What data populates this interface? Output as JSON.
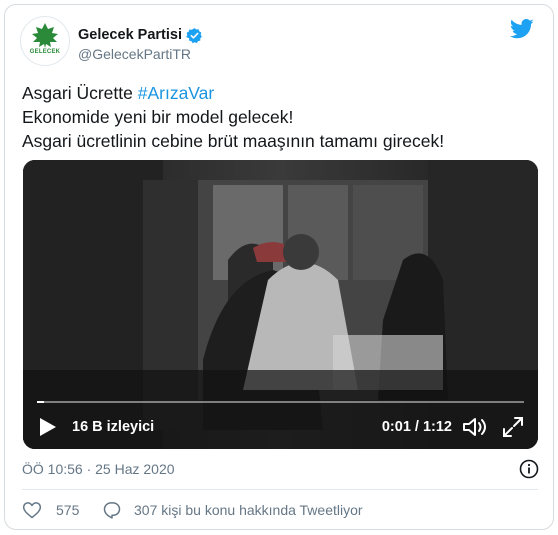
{
  "account": {
    "display_name": "Gelecek Partisi",
    "handle": "@GelecekPartiTR",
    "avatar_text": "GELECEK",
    "avatar_color": "#2a8a3a",
    "verified": true,
    "verified_icon": "verified-badge-icon",
    "logo_icon": "twitter-bird-icon"
  },
  "tweet": {
    "line1_prefix": "Asgari Ücrette ",
    "line1_hashtag": "#ArızaVar",
    "line2": "Ekonomide yeni bir model gelecek!",
    "line3": "Asgari ücretlinin cebine brüt maaşının tamamı girecek!",
    "hashtag_color": "#1b95e0"
  },
  "video": {
    "views": "16 B izleyici",
    "time": "0:01 / 1:12",
    "progress_fraction": 0.014,
    "play_icon": "play-icon",
    "volume_icon": "volume-icon",
    "fullscreen_icon": "fullscreen-icon"
  },
  "meta": {
    "timestamp": "ÖÖ 10:56 · 25 Haz 2020",
    "info_icon": "info-icon"
  },
  "actions": {
    "likes": "575",
    "reply_text": "307 kişi bu konu hakkında Tweetliyor",
    "like_icon": "heart-icon",
    "reply_icon": "reply-bubble-icon"
  }
}
